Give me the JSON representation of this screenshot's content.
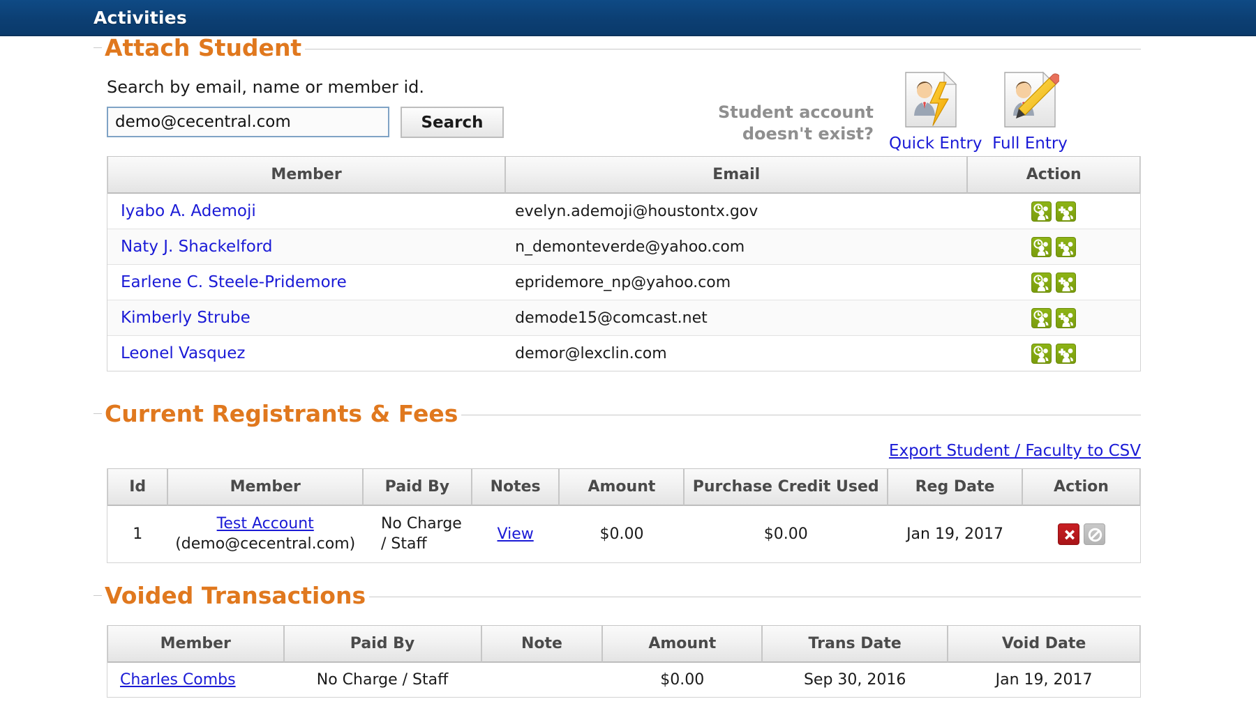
{
  "header": {
    "title": "Activities"
  },
  "colors": {
    "header_bg": "#0c3f73",
    "legend_orange": "#e0781e",
    "link_blue": "#1a1ad6",
    "action_green": "#8db416",
    "action_red": "#c91f23",
    "action_gray": "#c0c0c0"
  },
  "attach_student": {
    "legend": "Attach Student",
    "search_label": "Search by email, name or member id.",
    "search_value": "demo@cecentral.com",
    "search_placeholder": "",
    "search_button": "Search",
    "no_account_line1": "Student account",
    "no_account_line2": "doesn't exist?",
    "quick_entry_label": "Quick Entry",
    "full_entry_label": "Full Entry",
    "columns": [
      "Member",
      "Email",
      "Action"
    ],
    "rows": [
      {
        "member": "Iyabo A. Ademoji",
        "email": "evelyn.ademoji@houstontx.gov"
      },
      {
        "member": "Naty J. Shackelford",
        "email": "n_demonteverde@yahoo.com"
      },
      {
        "member": "Earlene C. Steele-Pridemore",
        "email": "epridemore_np@yahoo.com"
      },
      {
        "member": "Kimberly Strube",
        "email": "demode15@comcast.net"
      },
      {
        "member": "Leonel Vasquez",
        "email": "demor@lexclin.com"
      }
    ]
  },
  "current_registrants": {
    "legend": "Current Registrants & Fees",
    "export_link": "Export Student / Faculty to CSV",
    "columns": [
      "Id",
      "Member",
      "Paid By",
      "Notes",
      "Amount",
      "Purchase Credit Used",
      "Reg Date",
      "Action"
    ],
    "rows": [
      {
        "id": "1",
        "member_name": "Test Account",
        "member_email": "(demo@cecentral.com)",
        "paid_by_line1": "No Charge",
        "paid_by_line2": "/ Staff",
        "notes": "View",
        "amount": "$0.00",
        "purchase_credit_used": "$0.00",
        "reg_date": "Jan 19, 2017"
      }
    ]
  },
  "voided_transactions": {
    "legend": "Voided Transactions",
    "columns": [
      "Member",
      "Paid By",
      "Note",
      "Amount",
      "Trans Date",
      "Void Date"
    ],
    "rows": [
      {
        "member": "Charles Combs",
        "paid_by": "No Charge / Staff",
        "note": "",
        "amount": "$0.00",
        "trans_date": "Sep 30, 2016",
        "void_date": "Jan 19, 2017"
      }
    ]
  }
}
